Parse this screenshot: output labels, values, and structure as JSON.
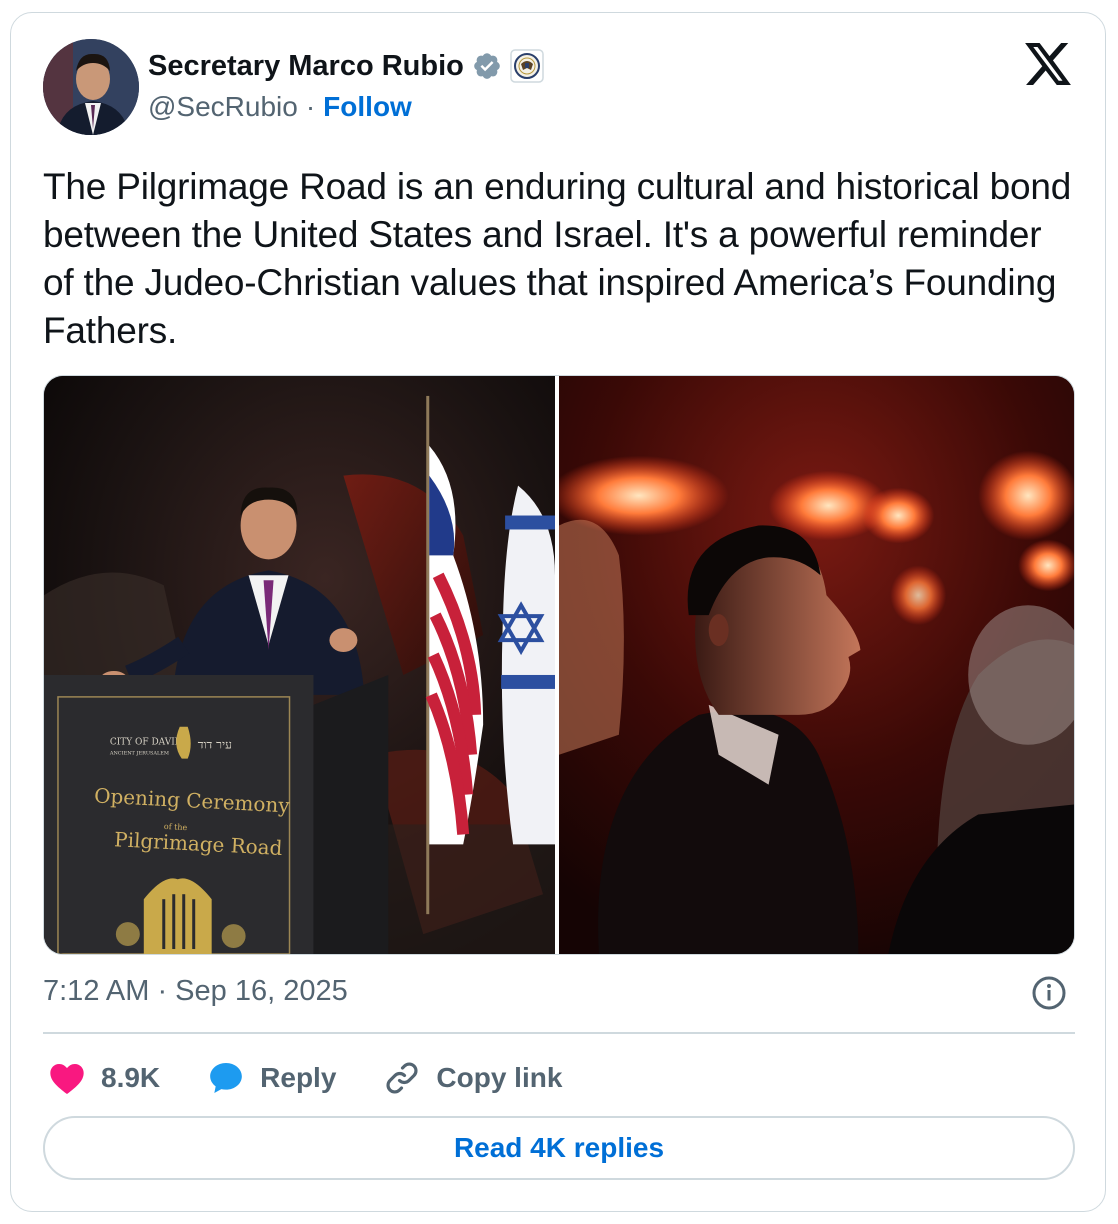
{
  "author": {
    "name": "Secretary Marco Rubio",
    "handle": "@SecRubio",
    "separator": "·",
    "follow_label": "Follow",
    "badges": [
      "verified-check-icon",
      "state-department-seal-icon"
    ]
  },
  "brand": {
    "logo": "x-logo-icon"
  },
  "tweet": {
    "text": "The Pilgrimage Road is an enduring cultural and historical bond between the United States and Israel. It's a powerful reminder of the Judeo-Christian values that inspired America’s Founding Fathers."
  },
  "media": {
    "left_photo": {
      "podium_lines": [
        "CITY OF DAVID",
        "ANCIENT JERUSALEM",
        "עיר דוד",
        "Opening Ceremony",
        "of the",
        "Pilgrimage Road"
      ]
    }
  },
  "meta": {
    "timestamp": "7:12 AM · Sep 16, 2025",
    "info_icon": "info-icon"
  },
  "actions": {
    "like_count": "8.9K",
    "reply_label": "Reply",
    "copy_label": "Copy link"
  },
  "read_replies_label": "Read 4K replies",
  "colors": {
    "accent": "#006fd6",
    "like": "#f91880",
    "reply_icon": "#1d9bf0",
    "muted": "#536471",
    "border": "#cfd9de"
  }
}
